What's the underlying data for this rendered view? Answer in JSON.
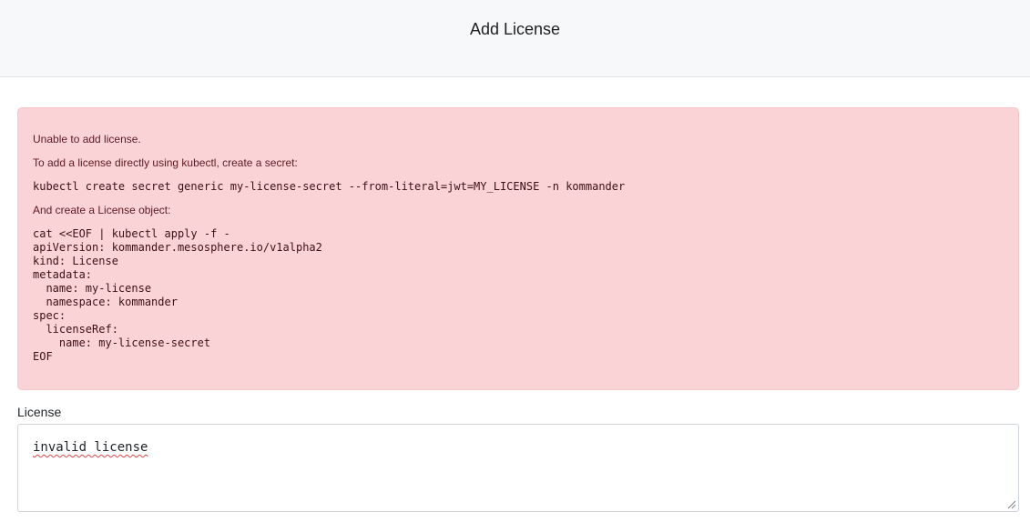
{
  "header": {
    "title": "Add License"
  },
  "alert": {
    "message": "Unable to add license.",
    "secret_instruction": "To add a license directly using kubectl, create a secret:",
    "secret_command": "kubectl create secret generic my-license-secret --from-literal=jwt=MY_LICENSE -n kommander",
    "object_instruction": "And create a License object:",
    "object_manifest": "cat <<EOF | kubectl apply -f -\napiVersion: kommander.mesosphere.io/v1alpha2\nkind: License\nmetadata:\n  name: my-license\n  namespace: kommander\nspec:\n  licenseRef:\n    name: my-license-secret\nEOF"
  },
  "form": {
    "license_label": "License",
    "license_value": "invalid license"
  },
  "colors": {
    "alert_background": "#fad3d6",
    "alert_text": "#5c1a22",
    "header_background": "#f7f8f9"
  }
}
